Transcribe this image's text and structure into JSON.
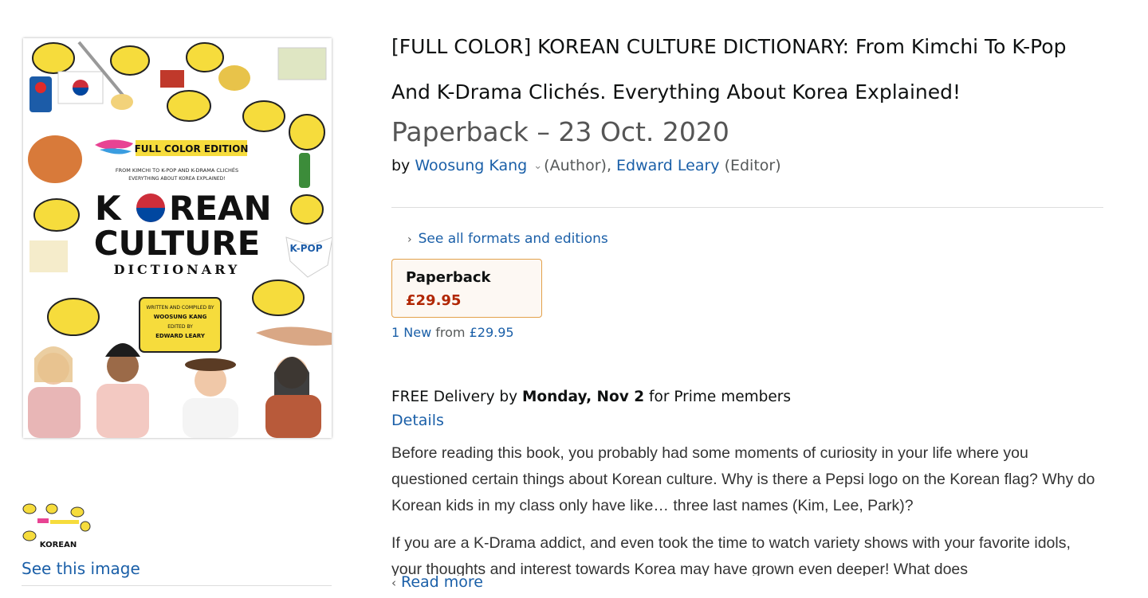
{
  "product": {
    "title": "[FULL COLOR] KOREAN CULTURE DICTIONARY: From Kimchi To K-Pop And K-Drama Clichés. Everything About Korea Explained!",
    "binding_date": "Paperback – 23 Oct. 2020",
    "byline": {
      "by": "by",
      "author_name": "Woosung Kang",
      "author_role": "(Author),",
      "editor_name": "Edward Leary",
      "editor_role": "(Editor)"
    }
  },
  "cover": {
    "edition_badge": "FULL COLOR EDITION",
    "tagline_1": "FROM KIMCHI TO K-POP AND K-DRAMA CLICHÉS",
    "tagline_2": "EVERYTHING ABOUT KOREA EXPLAINED!",
    "title_line_1a": "K",
    "title_line_1b": "REAN",
    "title_line_2": "CULTURE",
    "title_line_3": "DICTIONARY",
    "credit_1": "WRITTEN AND COMPILED BY",
    "credit_2": "WOOSUNG KANG",
    "credit_3": "EDITED BY",
    "credit_4": "EDWARD LEARY",
    "kpop_badge": "K-POP"
  },
  "gallery": {
    "see_image_label": "See this image",
    "thumb_text": "KOREAN"
  },
  "formats": {
    "see_all_label": "See all formats and editions",
    "selected_format": "Paperback",
    "selected_price": "£29.95",
    "offers_count": "1 New",
    "offers_from": "from",
    "offers_price": "£29.95"
  },
  "delivery": {
    "prefix": "FREE Delivery by",
    "date": "Monday, Nov 2",
    "suffix": "for Prime members",
    "details_label": "Details"
  },
  "description": {
    "paragraph_1": "Before reading this book, you probably had some moments of curiosity in your life where you questioned certain things about Korean culture. Why is there a Pepsi logo on the Korean flag? Why do Korean kids in my class only have like… three last names (Kim, Lee, Park)?",
    "paragraph_2": "If you are a K-Drama addict, and even took the time to watch variety shows with your favorite idols, your thoughts and interest towards Korea may have grown even deeper! What does",
    "read_more_label": "Read more"
  },
  "colors": {
    "link": "#1a5fa8",
    "price": "#b12704",
    "format_border": "#e3a14b",
    "format_bg": "#fdf8f3",
    "bubble_yellow": "#f6dc3c"
  },
  "icons": {
    "chevron_down": "chevron-down-icon",
    "chevron_right": "chevron-right-icon",
    "chevron_left": "chevron-left-icon"
  }
}
